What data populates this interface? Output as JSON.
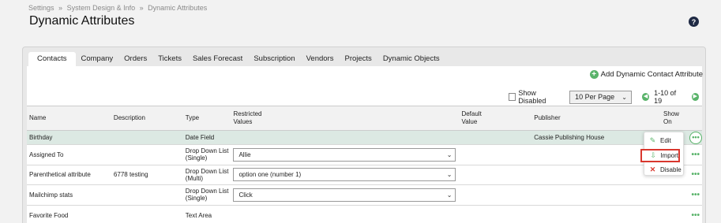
{
  "breadcrumb": [
    "Settings",
    "»",
    "System Design & Info",
    "»",
    "Dynamic Attributes"
  ],
  "page_title": "Dynamic Attributes",
  "help_icon": "?",
  "tabs": [
    {
      "label": "Contacts",
      "active": true
    },
    {
      "label": "Company"
    },
    {
      "label": "Orders"
    },
    {
      "label": "Tickets"
    },
    {
      "label": "Sales Forecast"
    },
    {
      "label": "Subscription"
    },
    {
      "label": "Vendors"
    },
    {
      "label": "Projects"
    },
    {
      "label": "Dynamic Objects"
    }
  ],
  "add_attribute_label": "Add Dynamic Contact Attribute",
  "show_disabled_label": "Show Disabled",
  "per_page": "10 Per Page",
  "pagination": "1-10 of 19",
  "columns": {
    "name": "Name",
    "description": "Description",
    "type": "Type",
    "restricted_1": "Restricted",
    "restricted_2": "Values",
    "default_1": "Default",
    "default_2": "Value",
    "publisher": "Publisher",
    "show_1": "Show",
    "show_2": "On"
  },
  "rows": [
    {
      "name": "Birthday",
      "description": "",
      "type1": "Date Field",
      "type2": "",
      "restricted": "",
      "publisher": "Cassie Publishing House"
    },
    {
      "name": "Assigned To",
      "description": "",
      "type1": "Drop Down List",
      "type2": "(Single)",
      "restricted": "Allie",
      "publisher": ""
    },
    {
      "name": "Parenthetical attribute",
      "description": "6778 testing",
      "type1": "Drop Down List",
      "type2": "(Multi)",
      "restricted": "option one (number 1)",
      "publisher": ""
    },
    {
      "name": "Mailchimp stats",
      "description": "",
      "type1": "Drop Down List",
      "type2": "(Single)",
      "restricted": "Click",
      "publisher": ""
    },
    {
      "name": "Favorite Food",
      "description": "",
      "type1": "Text Area",
      "type2": "",
      "restricted": "",
      "publisher": ""
    }
  ],
  "context_menu": {
    "edit": "Edit",
    "import": "Import",
    "disable": "Disable"
  },
  "colors": {
    "accent_green": "#59b36a",
    "highlight_row": "#dce9e3",
    "danger_red": "#d9372e"
  }
}
